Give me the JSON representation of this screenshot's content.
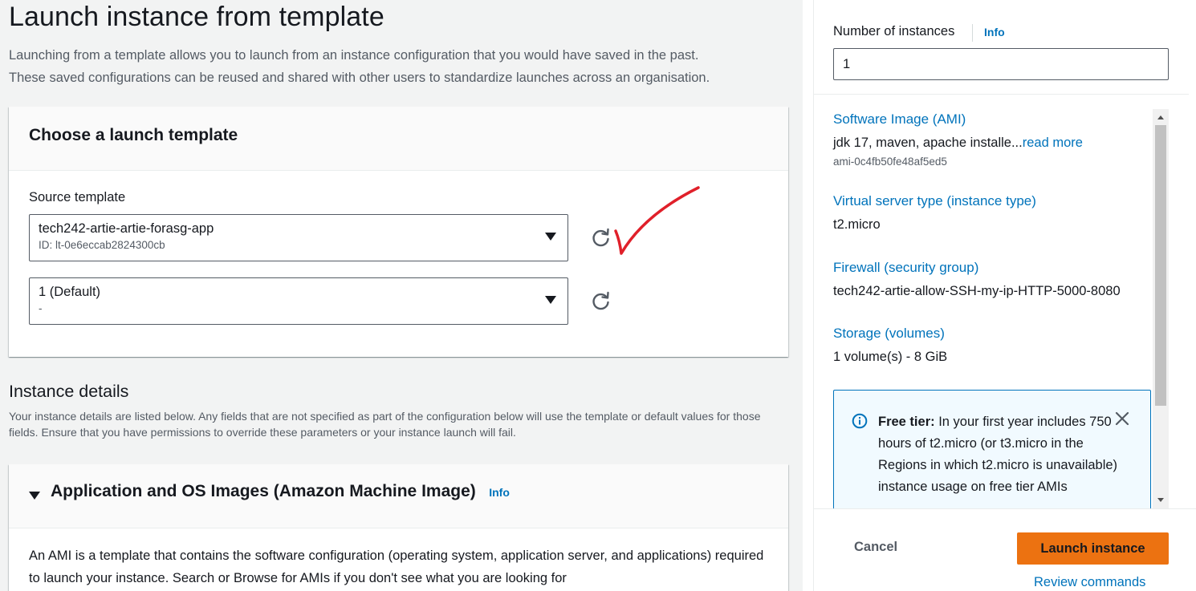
{
  "page": {
    "title": "Launch instance from template",
    "description_line1": "Launching from a template allows you to launch from an instance configuration that you would have saved in the past.",
    "description_line2": "These saved configurations can be reused and shared with other users to standardize launches across an organisation."
  },
  "template_card": {
    "title": "Choose a launch template",
    "source_label": "Source template",
    "source_value": "tech242-artie-artie-forasg-app",
    "source_id": "ID: lt-0e6eccab2824300cb",
    "version_value": "1 (Default)",
    "version_sub": "-"
  },
  "instance_details": {
    "title": "Instance details",
    "description": "Your instance details are listed below. Any fields that are not specified as part of the configuration below will use the template or default values for those fields. Ensure that you have permissions to override these parameters or your instance launch will fail."
  },
  "ami_section": {
    "title": "Application and OS Images (Amazon Machine Image)",
    "info": "Info",
    "description": "An AMI is a template that contains the software configuration (operating system, application server, and applications) required to launch your instance. Search or Browse for AMIs if you don't see what you are looking for"
  },
  "summary": {
    "num_instances_label": "Number of instances",
    "num_instances_info": "Info",
    "num_instances_value": "1",
    "ami_label": "Software Image (AMI)",
    "ami_value": "jdk 17, maven, apache installe...",
    "ami_read_more": "read more",
    "ami_id": "ami-0c4fb50fe48af5ed5",
    "instance_type_label": "Virtual server type (instance type)",
    "instance_type_value": "t2.micro",
    "firewall_label": "Firewall (security group)",
    "firewall_value": "tech242-artie-allow-SSH-my-ip-HTTP-5000-8080",
    "storage_label": "Storage (volumes)",
    "storage_value": "1 volume(s) - 8 GiB",
    "free_tier_bold": "Free tier:",
    "free_tier_text": " In your first year includes 750 hours of t2.micro (or t3.micro in the Regions in which t2.micro is unavailable) instance usage on free tier AMIs"
  },
  "actions": {
    "cancel": "Cancel",
    "launch": "Launch instance",
    "review": "Review commands"
  },
  "colors": {
    "accent_link": "#0073bb",
    "primary_button": "#ec7211",
    "annotation_check": "#e0202a"
  },
  "icons": {
    "refresh": "refresh-icon",
    "caret": "caret-down-icon",
    "info": "info-circle-icon",
    "close": "close-icon",
    "annotation": "red-checkmark-annotation"
  }
}
